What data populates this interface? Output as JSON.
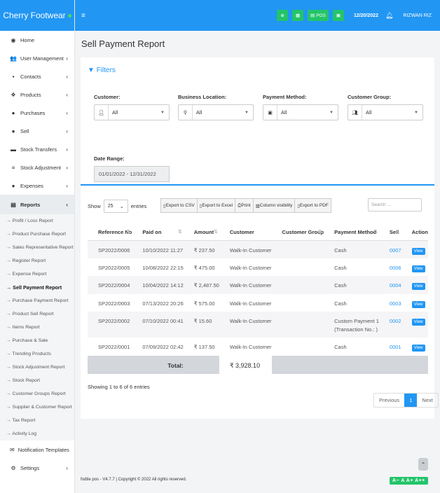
{
  "app": {
    "brand": "Cherry Footwear"
  },
  "topbar": {
    "menu_icon": "≡",
    "pos_label": "POS",
    "date": "12/20/2022",
    "user": "RIZWAN RIZ"
  },
  "sidebar": {
    "items": [
      {
        "label": "Home",
        "icon": "◉",
        "chev": ""
      },
      {
        "label": "User Management",
        "icon": "👥",
        "chev": "‹"
      },
      {
        "label": "Contacts",
        "icon": "▪",
        "chev": "‹"
      },
      {
        "label": "Products",
        "icon": "❖",
        "chev": "‹"
      },
      {
        "label": "Purchases",
        "icon": "●",
        "chev": "‹"
      },
      {
        "label": "Sell",
        "icon": "●",
        "chev": "‹"
      },
      {
        "label": "Stock Transfers",
        "icon": "▬",
        "chev": "‹"
      },
      {
        "label": "Stock Adjustment",
        "icon": "≡",
        "chev": "‹"
      },
      {
        "label": "Expenses",
        "icon": "●",
        "chev": "‹"
      }
    ],
    "reports": {
      "label": "Reports",
      "chev": "‹"
    },
    "report_items": [
      "→ Profit / Loss Report",
      "→ Product Purchase Report",
      "→ Sales Representative Report",
      "→ Register Report",
      "→ Expense Report",
      "→ Sell Payment Report",
      "→ Purchase Payment Report",
      "→ Product Sell Report",
      "→ Items Report",
      "→ Purchase & Sale",
      "→ Trending Products",
      "→ Stock Adjustment Report",
      "→ Stock Report",
      "→ Customer Groups Report",
      "→ Supplier & Customer Report",
      "→ Tax Report",
      "→ Activity Log"
    ],
    "bottom_items": [
      {
        "label": "Notification Templates",
        "icon": "✉",
        "chev": ""
      },
      {
        "label": "Settings",
        "icon": "⚙",
        "chev": "‹"
      }
    ]
  },
  "page": {
    "title": "Sell Payment Report"
  },
  "filters": {
    "title": "Filters",
    "customer_label": "Customer:",
    "customer_value": "All",
    "location_label": "Business Location:",
    "location_value": "All",
    "method_label": "Payment Method:",
    "method_value": "All",
    "group_label": "Customer Group:",
    "group_value": "All",
    "date_label": "Date Range:",
    "date_value": "01/01/2022 - 12/31/2022"
  },
  "table_controls": {
    "show": "Show",
    "entries_value": "25",
    "entries": "entries",
    "export_csv": "Export to CSV",
    "export_excel": "Export to Excel",
    "print": "Print",
    "column_visibility": "Column visibility",
    "export_pdf": "Export to PDF",
    "search_placeholder": "Search ..."
  },
  "table": {
    "headers": [
      "Reference No",
      "Paid on",
      "Amount",
      "Customer",
      "Customer Group",
      "Payment Method",
      "Sell",
      "Action"
    ],
    "rows": [
      {
        "ref": "SP2022/0006",
        "paid": "10/10/2022 11:27",
        "amount": "₹ 237.50",
        "customer": "Walk-In Customer",
        "group": "",
        "method": "Cash",
        "method2": "",
        "sell": "0007",
        "action": "View"
      },
      {
        "ref": "SP2022/0005",
        "paid": "10/08/2022 22:15",
        "amount": "₹ 475.00",
        "customer": "Walk-In Customer",
        "group": "",
        "method": "Cash",
        "method2": "",
        "sell": "0006",
        "action": "View"
      },
      {
        "ref": "SP2022/0004",
        "paid": "10/04/2022 14:12",
        "amount": "₹ 2,487.50",
        "customer": "Walk-In Customer",
        "group": "",
        "method": "Cash",
        "method2": "",
        "sell": "0004",
        "action": "View"
      },
      {
        "ref": "SP2022/0003",
        "paid": "07/13/2022 20:26",
        "amount": "₹ 575.00",
        "customer": "Walk-In Customer",
        "group": "",
        "method": "Cash",
        "method2": "",
        "sell": "0003",
        "action": "View"
      },
      {
        "ref": "SP2022/0002",
        "paid": "07/10/2022 00:41",
        "amount": "₹ 15.60",
        "customer": "Walk-In Customer",
        "group": "",
        "method": "Custom Payment 1",
        "method2": "(Transaction No.: )",
        "sell": "0002",
        "action": "View"
      },
      {
        "ref": "SP2022/0001",
        "paid": "07/09/2022 02:42",
        "amount": "₹ 137.50",
        "customer": "Walk-In Customer",
        "group": "",
        "method": "Cash",
        "method2": "",
        "sell": "0001",
        "action": "View"
      }
    ],
    "total_label": "Total:",
    "total_value": "₹ 3,928.10"
  },
  "pagination": {
    "info": "Showing 1 to 6 of 6 entries",
    "previous": "Previous",
    "page": "1",
    "next": "Next"
  },
  "footer": {
    "text": "fodtie pos - V4.7.7 | Copyright © 2022 All rights reserved.",
    "font_size_ctrl": "A− A A+ A++"
  },
  "colors": {
    "primary": "#2196f3",
    "success": "#23c46a"
  }
}
